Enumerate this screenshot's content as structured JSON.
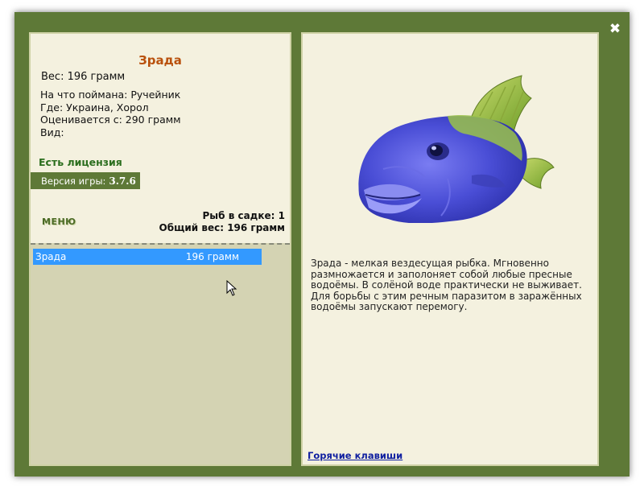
{
  "window": {
    "close_icon": "close-x-icon"
  },
  "fish": {
    "name": "Зрада",
    "weight": "Вес: 196 грамм",
    "caught_on": "На что поймана: Ручейник",
    "location": "Где: Украина, Хорол",
    "valued_from": "Оценивается с: 290 грамм",
    "species": "Вид:",
    "description": "Зрада - мелкая вездесущая рыбка. Мгновенно размножается и заполоняет собой любые пресные водоёмы. В солёной воде практически не выживает. Для борьбы с этим речным паразитом в заражённых водоёмы запускают перемогу."
  },
  "license": "Есть лицензия",
  "version": {
    "label": "Версия игры:",
    "value": "3.7.6"
  },
  "menu_label": "МЕНЮ",
  "keepnet": {
    "count_text": "Рыб в садке: 1",
    "total_weight_text": "Общий вес: 196 грамм",
    "items": [
      {
        "name": "Зрада",
        "weight": "196 грамм"
      }
    ]
  },
  "hotkeys_link": "Горячие клавиши",
  "colors": {
    "frame": "#5e7937",
    "panel_bg": "#f4f1df",
    "list_bg": "#d4d3b3",
    "title": "#b9510d",
    "license": "#2b6e1e",
    "selection": "#3399ff",
    "link": "#1020a0"
  }
}
